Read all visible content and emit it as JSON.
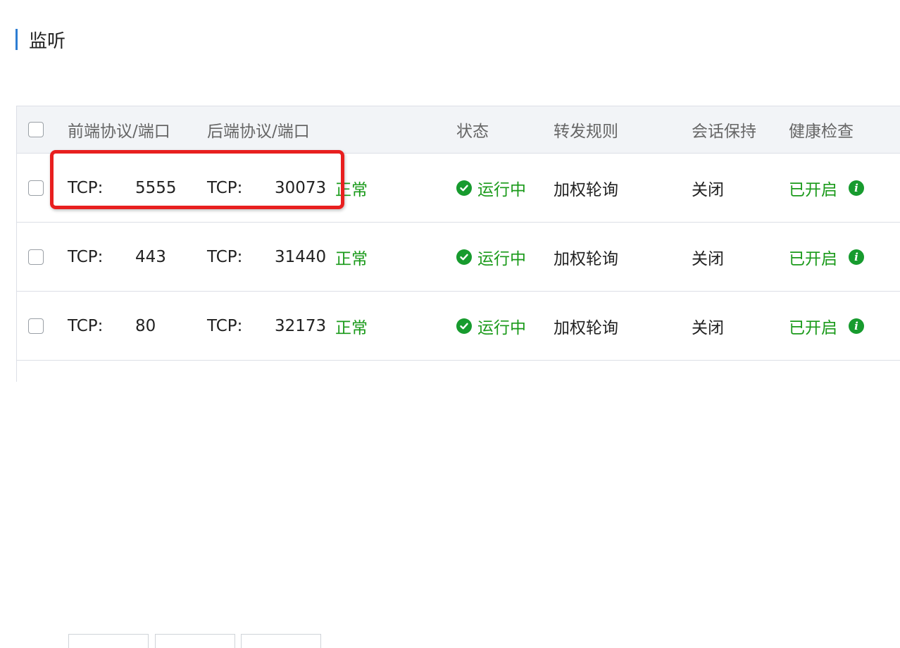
{
  "section": {
    "title": "监听"
  },
  "table": {
    "headers": {
      "frontend": "前端协议/端口",
      "backend": "后端协议/端口",
      "status": "状态",
      "forward_rule": "转发规则",
      "session": "会话保持",
      "health": "健康检查"
    },
    "rows": [
      {
        "frontend_protocol": "TCP:",
        "frontend_port": "5555",
        "backend_protocol": "TCP:",
        "backend_port": "30073",
        "backend_state": "正常",
        "status": "运行中",
        "forward_rule": "加权轮询",
        "session": "关闭",
        "health": "已开启"
      },
      {
        "frontend_protocol": "TCP:",
        "frontend_port": "443",
        "backend_protocol": "TCP:",
        "backend_port": "31440",
        "backend_state": "正常",
        "status": "运行中",
        "forward_rule": "加权轮询",
        "session": "关闭",
        "health": "已开启"
      },
      {
        "frontend_protocol": "TCP:",
        "frontend_port": "80",
        "backend_protocol": "TCP:",
        "backend_port": "32173",
        "backend_state": "正常",
        "status": "运行中",
        "forward_rule": "加权轮询",
        "session": "关闭",
        "health": "已开启"
      }
    ]
  },
  "icons": {
    "status": "check-circle-icon",
    "health_info": "info-icon"
  },
  "colors": {
    "accent": "#2d7dd2",
    "success": "#1a9a1a",
    "highlight": "#e81f1f",
    "header_bg": "#f2f4f7",
    "border": "#dcdfe6"
  }
}
